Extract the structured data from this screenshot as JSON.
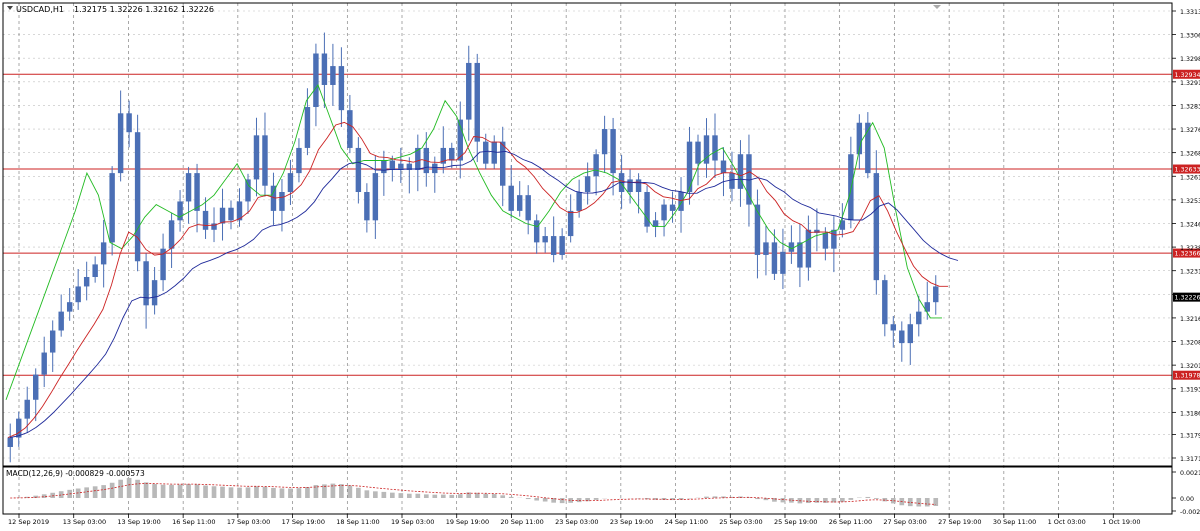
{
  "header": {
    "symbol_label": "USDCAD,H1",
    "ohlc_text": "1.32175 1.32226 1.32162 1.32226"
  },
  "colors": {
    "background": "#ffffff",
    "grid": "#c0c0c0",
    "candles": "#4b6fb5",
    "ma_fast": "#22bb22",
    "ma_mid": "#cc2222",
    "ma_slow": "#1f2a9a",
    "level_line": "#cc2222",
    "level_badge": "#cc2222",
    "price_badge": "#000000",
    "macd_hist": "#b9b9b9",
    "macd_signal": "#cc2222"
  },
  "chart_data": {
    "type": "candlestick",
    "title": "USDCAD,H1",
    "y_axis": {
      "ticks": [
        "1.33135",
        "1.33060",
        "1.32985",
        "1.32910",
        "1.32835",
        "1.32760",
        "1.32685",
        "1.32610",
        "1.32535",
        "1.32460",
        "1.32385",
        "1.32310",
        "1.32235",
        "1.32160",
        "1.32085",
        "1.32010",
        "1.31935",
        "1.31860",
        "1.31790",
        "1.31715"
      ],
      "range": [
        1.31715,
        1.33135
      ]
    },
    "x_axis": {
      "ticks": [
        "12 Sep 2019",
        "13 Sep 03:00",
        "13 Sep 19:00",
        "16 Sep 11:00",
        "17 Sep 03:00",
        "17 Sep 19:00",
        "18 Sep 11:00",
        "19 Sep 03:00",
        "19 Sep 19:00",
        "20 Sep 11:00",
        "23 Sep 03:00",
        "23 Sep 19:00",
        "24 Sep 11:00",
        "25 Sep 03:00",
        "25 Sep 19:00",
        "26 Sep 11:00",
        "27 Sep 03:00",
        "27 Sep 19:00",
        "30 Sep 11:00",
        "1 Oct 03:00",
        "1 Oct 19:00"
      ]
    },
    "horizontal_levels": [
      {
        "label": "1.32934",
        "value": 1.32934
      },
      {
        "label": "1.32633",
        "value": 1.32633
      },
      {
        "label": "1.32366",
        "value": 1.32366
      },
      {
        "label": "1.31978",
        "value": 1.31978
      }
    ],
    "current_price": {
      "label": "1.32226",
      "value": 1.32226
    },
    "closes": [
      1.3178,
      1.3184,
      1.319,
      1.3198,
      1.3205,
      1.3212,
      1.3218,
      1.3221,
      1.3226,
      1.3229,
      1.3233,
      1.324,
      1.3262,
      1.3281,
      1.3275,
      1.3234,
      1.322,
      1.3228,
      1.3238,
      1.3247,
      1.3253,
      1.3262,
      1.325,
      1.3244,
      1.3246,
      1.3251,
      1.3247,
      1.3253,
      1.326,
      1.3274,
      1.3258,
      1.325,
      1.3256,
      1.3262,
      1.327,
      1.3283,
      1.33,
      1.329,
      1.3296,
      1.3282,
      1.327,
      1.3256,
      1.3247,
      1.3262,
      1.3266,
      1.3263,
      1.3265,
      1.3263,
      1.327,
      1.3262,
      1.3265,
      1.327,
      1.3266,
      1.3279,
      1.3297,
      1.3272,
      1.3265,
      1.3272,
      1.3258,
      1.325,
      1.3255,
      1.3247,
      1.324,
      1.3242,
      1.3236,
      1.3242,
      1.325,
      1.3256,
      1.3261,
      1.3268,
      1.3276,
      1.3262,
      1.3256,
      1.326,
      1.3256,
      1.3245,
      1.3247,
      1.3252,
      1.325,
      1.3256,
      1.3272,
      1.3265,
      1.3274,
      1.3266,
      1.3262,
      1.3257,
      1.3268,
      1.3252,
      1.3236,
      1.324,
      1.323,
      1.3237,
      1.324,
      1.3232,
      1.3244,
      1.3243,
      1.3238,
      1.3244,
      1.3247,
      1.3268,
      1.3278,
      1.3262,
      1.3228,
      1.3214,
      1.3212,
      1.3208,
      1.3214,
      1.3218,
      1.3221,
      1.3226
    ],
    "ma_fast": [
      1.319,
      1.32,
      1.321,
      1.322,
      1.323,
      1.324,
      1.325,
      1.3262,
      1.3255,
      1.324,
      1.3238,
      1.3242,
      1.3248,
      1.3252,
      1.325,
      1.3248,
      1.325,
      1.3252,
      1.3255,
      1.326,
      1.3265,
      1.3258,
      1.3255,
      1.3255,
      1.3262,
      1.3272,
      1.3285,
      1.329,
      1.328,
      1.327,
      1.3265,
      1.3266,
      1.3266,
      1.3266,
      1.3267,
      1.3268,
      1.327,
      1.3276,
      1.3285,
      1.328,
      1.327,
      1.3262,
      1.3255,
      1.325,
      1.3248,
      1.3246,
      1.3245,
      1.325,
      1.3256,
      1.326,
      1.3262,
      1.3263,
      1.3262,
      1.326,
      1.3255,
      1.325,
      1.3245,
      1.3245,
      1.325,
      1.3256,
      1.3265,
      1.3268,
      1.327,
      1.3264,
      1.3257,
      1.325,
      1.3244,
      1.324,
      1.3238,
      1.324,
      1.3242,
      1.3243,
      1.3244,
      1.3255,
      1.3272,
      1.3278,
      1.327,
      1.325,
      1.3232,
      1.3222,
      1.3216,
      1.3216
    ],
    "macd_panel": {
      "label": "MACD(12,26,9) -0.000829 -0.000573",
      "ticks": [
        "0.002142",
        "0.00",
        "-0.00237"
      ]
    }
  }
}
